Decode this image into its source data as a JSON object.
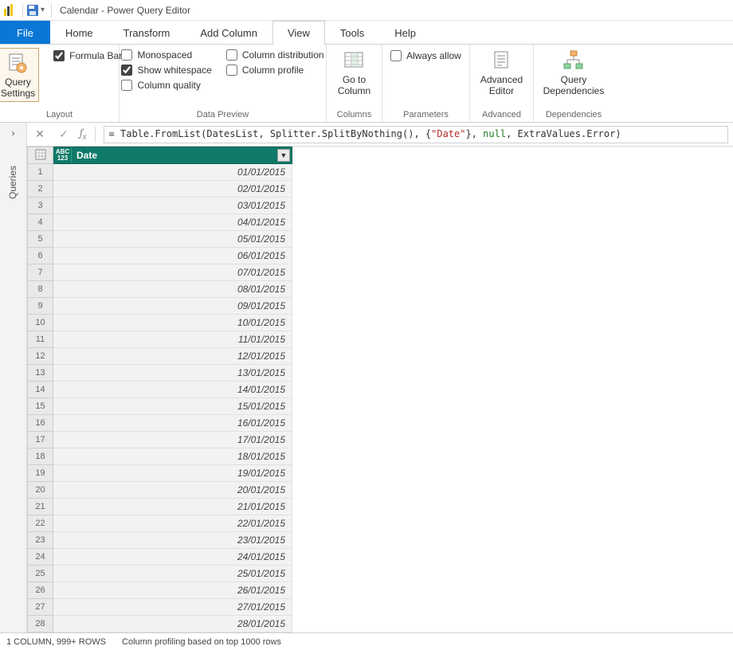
{
  "title": "Calendar - Power Query Editor",
  "tabs": {
    "file": "File",
    "home": "Home",
    "transform": "Transform",
    "addcol": "Add Column",
    "view": "View",
    "tools": "Tools",
    "help": "Help"
  },
  "ribbon": {
    "layout": {
      "label": "Layout",
      "querysettings": "Query\nSettings",
      "formulabar": "Formula Bar"
    },
    "preview": {
      "label": "Data Preview",
      "monospaced": "Monospaced",
      "showwhitespace": "Show whitespace",
      "colquality": "Column quality",
      "coldistribution": "Column distribution",
      "colprofile": "Column profile"
    },
    "columns": {
      "label": "Columns",
      "gotocolumn": "Go to\nColumn"
    },
    "parameters": {
      "label": "Parameters",
      "alwaysallow": "Always allow"
    },
    "advanced": {
      "label": "Advanced",
      "editor": "Advanced\nEditor"
    },
    "dependencies": {
      "label": "Dependencies",
      "query": "Query\nDependencies"
    }
  },
  "sidepane": {
    "queries": "Queries"
  },
  "formula": {
    "prefix": "= Table.FromList(DatesList, Splitter.SplitByNothing(), {",
    "stringlit": "\"Date\"",
    "middle": "}, ",
    "null": "null",
    "suffix": ", ExtraValues.Error)"
  },
  "column": {
    "type": "ABC\n123",
    "name": "Date"
  },
  "rows": [
    "01/01/2015",
    "02/01/2015",
    "03/01/2015",
    "04/01/2015",
    "05/01/2015",
    "06/01/2015",
    "07/01/2015",
    "08/01/2015",
    "09/01/2015",
    "10/01/2015",
    "11/01/2015",
    "12/01/2015",
    "13/01/2015",
    "14/01/2015",
    "15/01/2015",
    "16/01/2015",
    "17/01/2015",
    "18/01/2015",
    "19/01/2015",
    "20/01/2015",
    "21/01/2015",
    "22/01/2015",
    "23/01/2015",
    "24/01/2015",
    "25/01/2015",
    "26/01/2015",
    "27/01/2015",
    "28/01/2015"
  ],
  "status": {
    "cols": "1 COLUMN, 999+ ROWS",
    "profiling": "Column profiling based on top 1000 rows"
  }
}
